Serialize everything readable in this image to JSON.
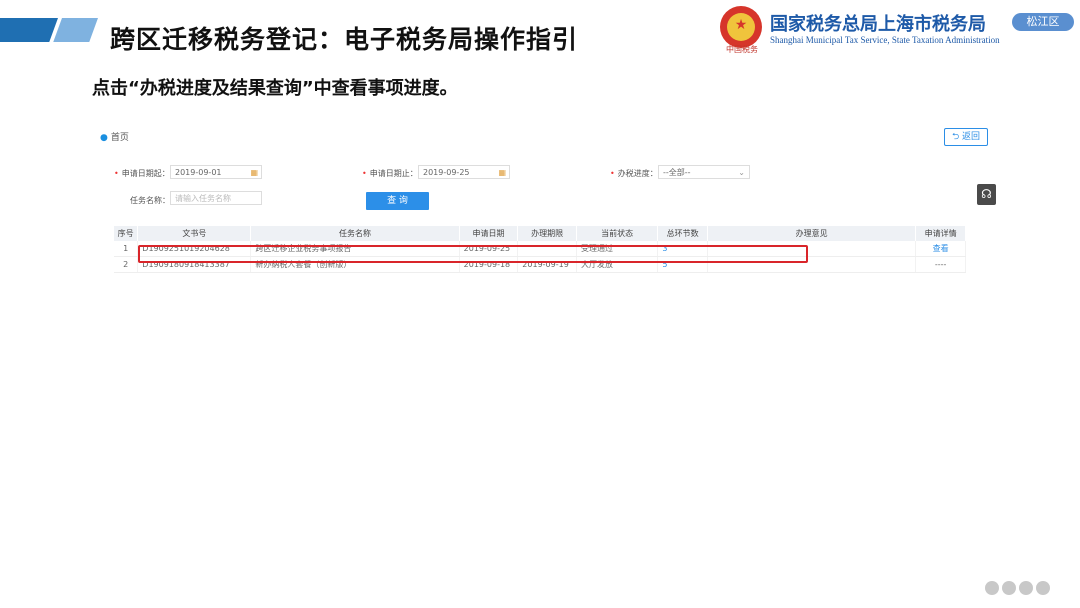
{
  "header": {
    "title": "跨区迁移税务登记：电子税务局操作指引",
    "org_name_cn": "国家税务总局上海市税务局",
    "org_name_en": "Shanghai Municipal Tax Service, State Taxation Administration",
    "emblem_caption": "中国税务",
    "district_badge": "松江区"
  },
  "subtitle": "点击“办税进度及结果查询”中查看事项进度。",
  "portal": {
    "breadcrumb": "首页",
    "back_label": "返回",
    "filters": {
      "start_label": "申请日期起：",
      "start_value": "2019-09-01",
      "end_label": "申请日期止：",
      "end_value": "2019-09-25",
      "progress_label": "办税进度：",
      "progress_value": "--全部--",
      "task_label": "任务名称：",
      "task_placeholder": "请输入任务名称",
      "query_label": "查 询"
    },
    "table": {
      "columns": [
        "序号",
        "文书号",
        "任务名称",
        "申请日期",
        "办理期限",
        "当前状态",
        "总环节数",
        "办理意见",
        "申请详情"
      ],
      "rows": [
        {
          "no": "1",
          "doc": "D1909251019204628",
          "task": "跨区迁移企业税务事项报告",
          "apply_date": "2019-09-25",
          "deadline": "",
          "status": "受理通过",
          "steps": "3",
          "opinion": "",
          "detail": "查看"
        },
        {
          "no": "2",
          "doc": "D1909180918413387",
          "task": "新办纳税人套餐（创新版）",
          "apply_date": "2019-09-18",
          "deadline": "2019-09-19",
          "status": "大厅发放",
          "steps": "5",
          "opinion": "",
          "detail": "----"
        }
      ]
    }
  },
  "colors": {
    "brand_blue": "#1e5aa8",
    "accent_blue": "#2c8fe8",
    "highlight_red": "#d9252a"
  }
}
